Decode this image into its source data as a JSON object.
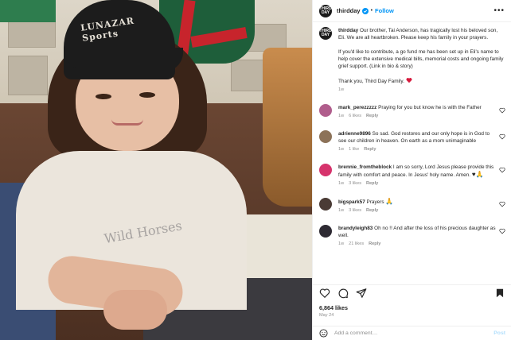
{
  "post": {
    "username": "thirdday",
    "avatar_text": "THIRD DAY",
    "follow_label": "Follow",
    "separator": "•",
    "more": "•••"
  },
  "photo": {
    "cap_text": "LUNAZAR Sports",
    "shirt_text": "Wild Horses"
  },
  "caption": {
    "username": "thirdday",
    "p1": "Our brother, Tai Anderson, has tragically lost his beloved son, Eli. We are all heartbroken. Please keep his family in your prayers.",
    "p2": "If you'd like to contribute, a go fund me has been set up in Eli's name to help cover the extensive medical bills, memorial costs and ongoing family grief support. (Link in bio & story)",
    "p3": "Thank you, Third Day Family.",
    "time": "1w"
  },
  "comments": [
    {
      "username": "mark_perezzzzz",
      "text": "Praying for you but know he is with the Father",
      "time": "1w",
      "likes": "6 likes",
      "reply": "Reply",
      "avatar_color": "#b05d8c"
    },
    {
      "username": "adrienne9896",
      "text": "So sad. God restores and our only hope is in God to see our children in heaven. On earth as a mom unimaginable",
      "time": "1w",
      "likes": "1 like",
      "reply": "Reply",
      "avatar_color": "#8c7258"
    },
    {
      "username": "brennie_fromtheblock",
      "text": "I am so sorry, Lord Jesus please provide this family with comfort and peace. In Jesus' holy name. Amen.",
      "emoji": "♥🙏",
      "time": "1w",
      "likes": "3 likes",
      "reply": "Reply",
      "avatar_color": "#d6336c"
    },
    {
      "username": "bigspark57",
      "text": "Prayers",
      "emoji": "🙏",
      "time": "1w",
      "likes": "3 likes",
      "reply": "Reply",
      "avatar_color": "#4a3b35"
    },
    {
      "username": "brandyleigh83",
      "text": "Oh no !! And after the loss of his precious daughter as well.",
      "time": "1w",
      "likes": "21 likes",
      "reply": "Reply",
      "avatar_color": "#2e2a33"
    }
  ],
  "footer": {
    "likes": "6,864 likes",
    "date": "May 24",
    "add_comment_placeholder": "Add a comment…",
    "post_label": "Post"
  },
  "colors": {
    "link": "#0095f6",
    "heart": "#ed4956",
    "muted": "#8e8e8e"
  },
  "icons": [
    "verified-icon",
    "heart-icon",
    "comment-icon",
    "share-icon",
    "save-icon",
    "emoji-icon",
    "more-icon"
  ]
}
